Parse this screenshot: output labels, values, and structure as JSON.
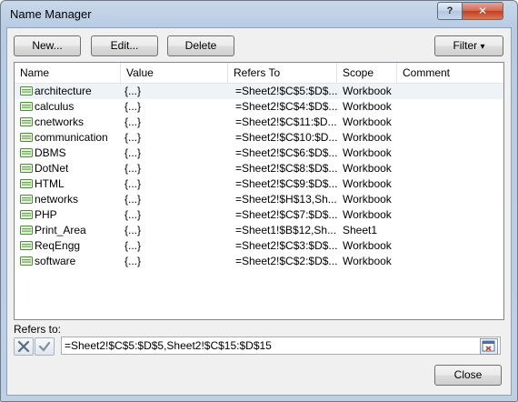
{
  "window": {
    "title": "Name Manager",
    "help_label": "?",
    "close_symbol": "✕"
  },
  "toolbar": {
    "new_label": "New...",
    "edit_label": "Edit...",
    "delete_label": "Delete",
    "filter_label": "Filter",
    "filter_arrow": "▾"
  },
  "columns": [
    "Name",
    "Value",
    "Refers To",
    "Scope",
    "Comment"
  ],
  "rows": [
    {
      "name": "architecture",
      "value": "{...}",
      "refers_to": "=Sheet2!$C$5:$D$...",
      "scope": "Workbook",
      "comment": ""
    },
    {
      "name": "calculus",
      "value": "{...}",
      "refers_to": "=Sheet2!$C$4:$D$...",
      "scope": "Workbook",
      "comment": ""
    },
    {
      "name": "cnetworks",
      "value": "{...}",
      "refers_to": "=Sheet2!$C$11:$D...",
      "scope": "Workbook",
      "comment": ""
    },
    {
      "name": "communication",
      "value": "{...}",
      "refers_to": "=Sheet2!$C$10:$D...",
      "scope": "Workbook",
      "comment": ""
    },
    {
      "name": "DBMS",
      "value": "{...}",
      "refers_to": "=Sheet2!$C$6:$D$...",
      "scope": "Workbook",
      "comment": ""
    },
    {
      "name": "DotNet",
      "value": "{...}",
      "refers_to": "=Sheet2!$C$8:$D$...",
      "scope": "Workbook",
      "comment": ""
    },
    {
      "name": "HTML",
      "value": "{...}",
      "refers_to": "=Sheet2!$C$9:$D$...",
      "scope": "Workbook",
      "comment": ""
    },
    {
      "name": "networks",
      "value": "{...}",
      "refers_to": "=Sheet2!$H$13,Sh...",
      "scope": "Workbook",
      "comment": ""
    },
    {
      "name": "PHP",
      "value": "{...}",
      "refers_to": "=Sheet2!$C$7:$D$...",
      "scope": "Workbook",
      "comment": ""
    },
    {
      "name": "Print_Area",
      "value": "{...}",
      "refers_to": "=Sheet1!$B$12,Sh...",
      "scope": "Sheet1",
      "comment": ""
    },
    {
      "name": "ReqEngg",
      "value": "{...}",
      "refers_to": "=Sheet2!$C$3:$D$...",
      "scope": "Workbook",
      "comment": ""
    },
    {
      "name": "software",
      "value": "{...}",
      "refers_to": "=Sheet2!$C$2:$D$...",
      "scope": "Workbook",
      "comment": ""
    }
  ],
  "refers_to_field": {
    "label": "Refers to:",
    "value": "=Sheet2!$C$5:$D$5,Sheet2!$C$15:$D$15"
  },
  "footer": {
    "close_label": "Close"
  },
  "colors": {
    "selected_row": "#eef3f8",
    "name_icon": "#6aa84f"
  },
  "icons": {
    "row": "named-range-icon",
    "cancel": "cancel-x-icon",
    "confirm": "checkmark-icon",
    "collapse": "collapse-dialog-icon"
  }
}
